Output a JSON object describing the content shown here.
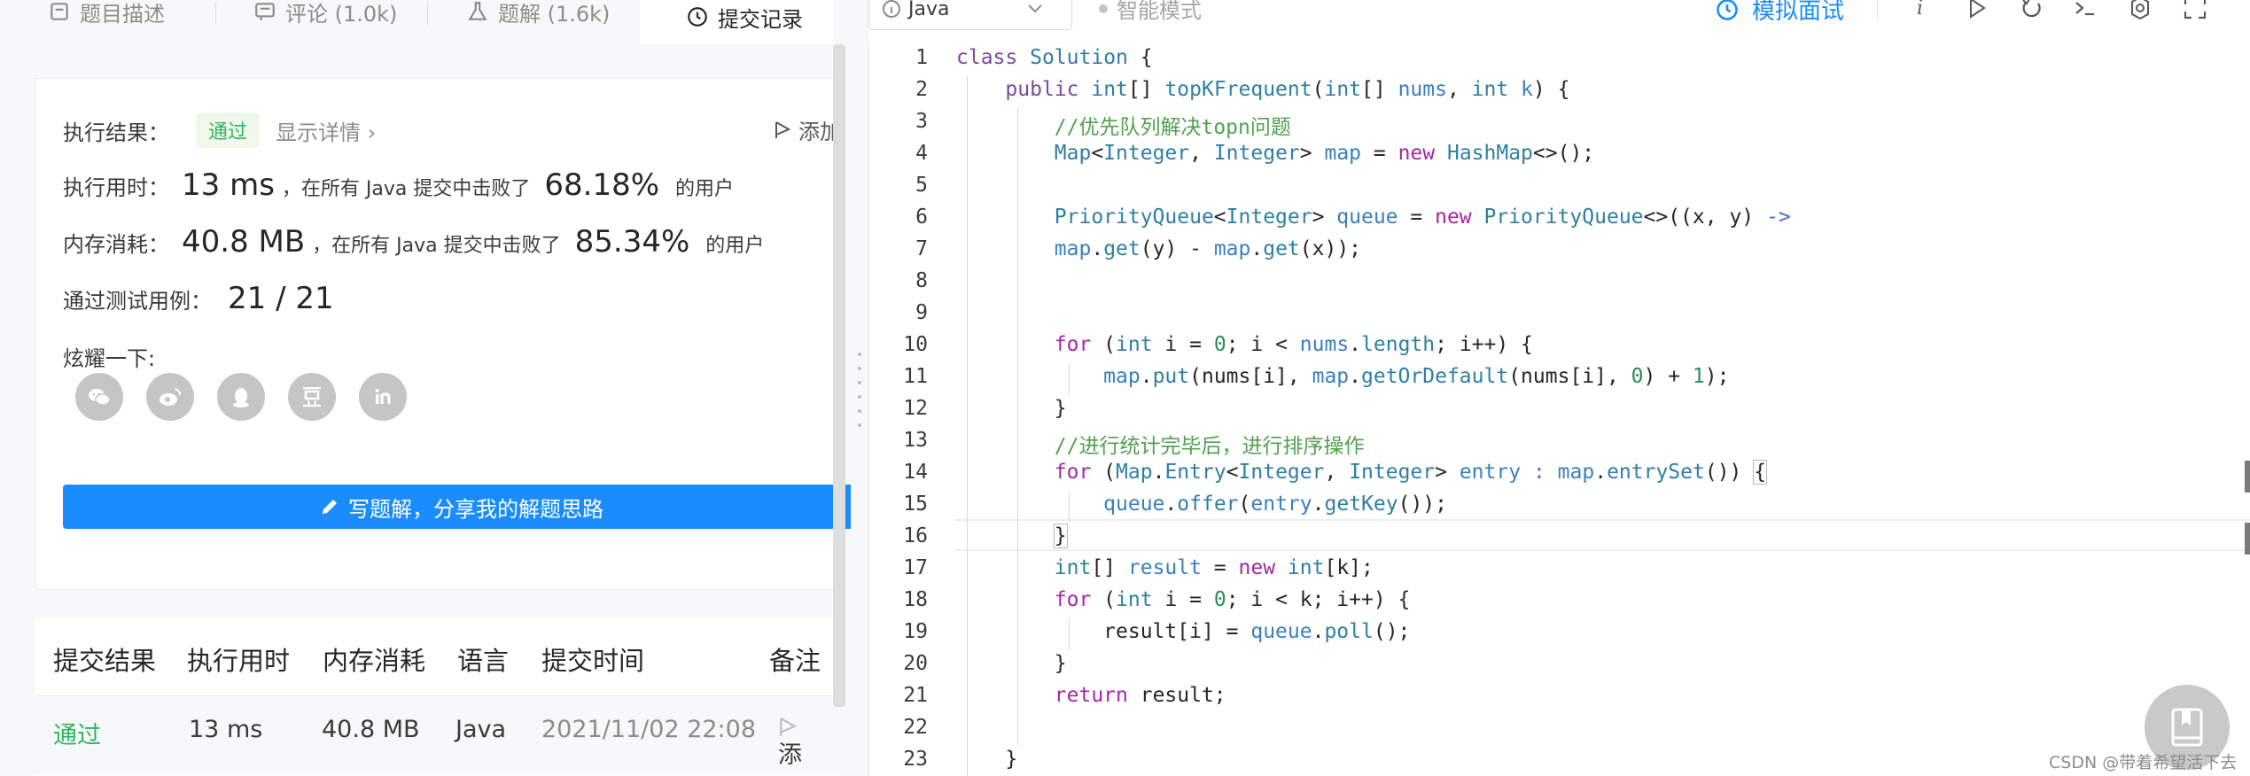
{
  "left_tabs": [
    {
      "label": "题目描述",
      "icon": "document-icon"
    },
    {
      "label": "评论 (1.0k)",
      "icon": "comment-icon"
    },
    {
      "label": "题解 (1.6k)",
      "icon": "flask-icon"
    },
    {
      "label": "提交记录",
      "icon": "clock-icon",
      "active": true
    }
  ],
  "result": {
    "exec_result_label": "执行结果：",
    "status": "通过",
    "show_detail": "显示详情 ›",
    "add_note": "添加",
    "time_label": "执行用时：",
    "time_value": "13 ms",
    "time_mid": "，在所有 Java 提交中击败了",
    "time_percent": "68.18%",
    "time_suffix": "的用户",
    "mem_label": "内存消耗：",
    "mem_value": "40.8 MB",
    "mem_mid": "，在所有 Java 提交中击败了",
    "mem_percent": "85.34%",
    "mem_suffix": "的用户",
    "tests_label": "通过测试用例：",
    "tests_value": "21 / 21",
    "share_label": "炫耀一下:",
    "share_icons": [
      "wechat-icon",
      "weibo-icon",
      "qq-icon",
      "douban-icon",
      "linkedin-icon"
    ],
    "write_button": "写题解，分享我的解题思路"
  },
  "submissions_table": {
    "headers": [
      "提交结果",
      "执行用时",
      "内存消耗",
      "语言",
      "提交时间",
      "备注"
    ],
    "rows": [
      {
        "result": "通过",
        "time": "13 ms",
        "memory": "40.8 MB",
        "language": "Java",
        "submitted_at": "2021/11/02 22:08",
        "note": "添"
      }
    ]
  },
  "toolbar": {
    "language": "Java",
    "smart_mode": "智能模式",
    "mock_interview": "模拟面试"
  },
  "editor": {
    "line_numbers": [
      "1",
      "2",
      "3",
      "4",
      "5",
      "6",
      "7",
      "8",
      "9",
      "10",
      "11",
      "12",
      "13",
      "14",
      "15",
      "16",
      "17",
      "18",
      "19",
      "20",
      "21",
      "22",
      "23"
    ],
    "current_line": 16
  },
  "colors": {
    "accent": "#1a8cff",
    "pass_green": "#2db55d"
  },
  "watermark": "CSDN @带着希望活下去"
}
